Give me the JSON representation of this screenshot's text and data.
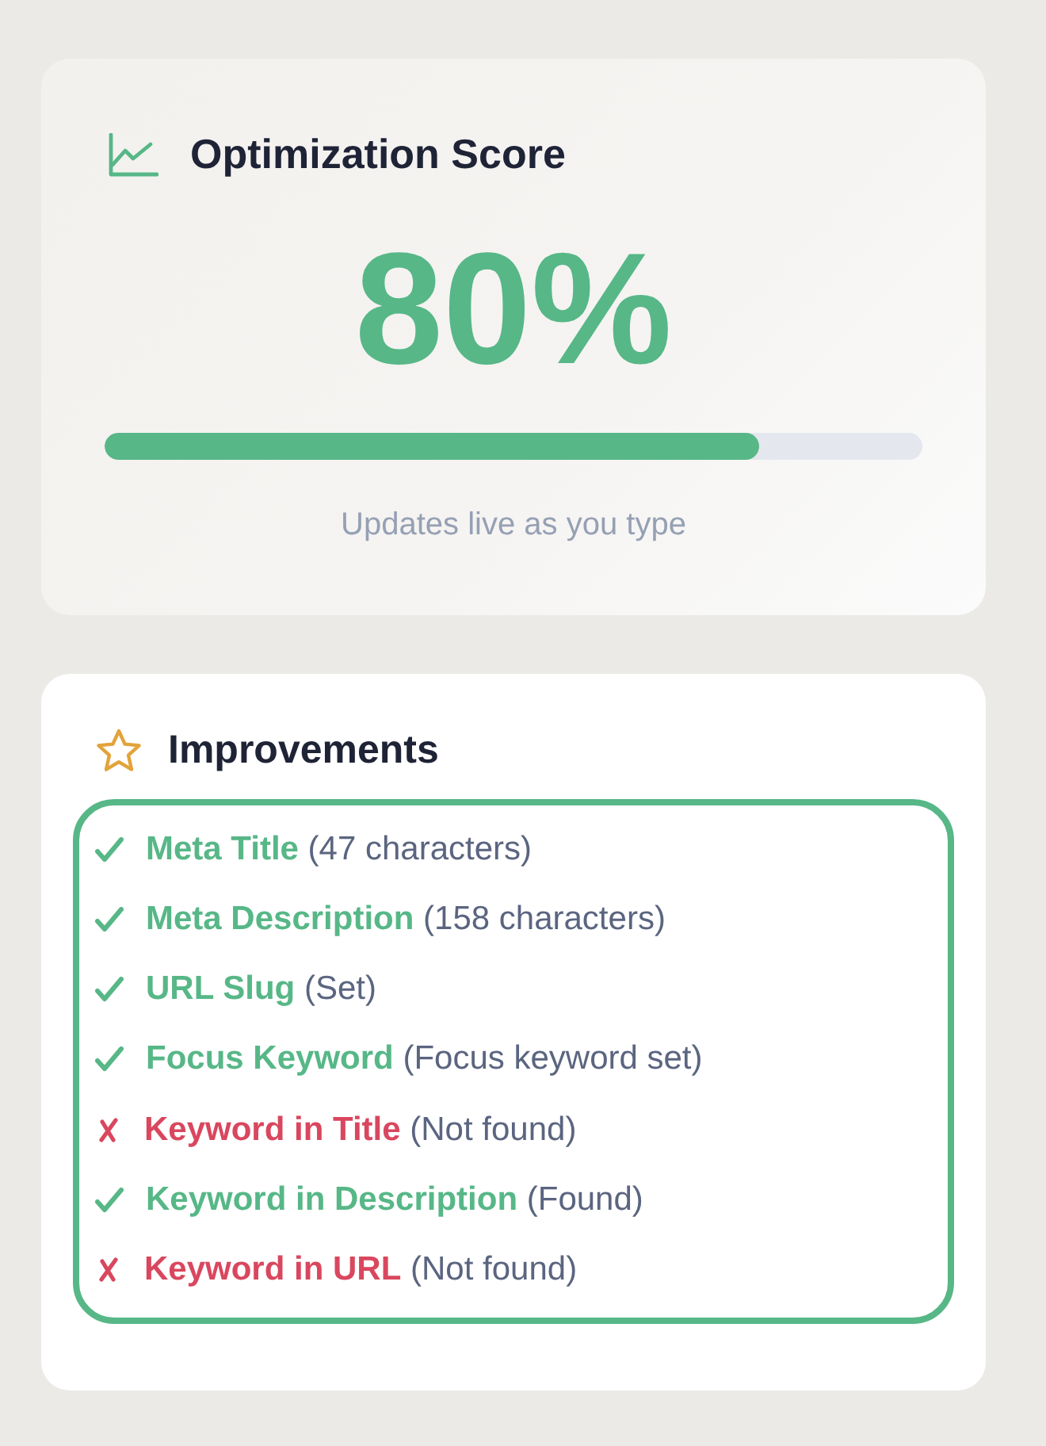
{
  "score_card": {
    "title": "Optimization Score",
    "score": "80%",
    "progress": {
      "level": 0.8
    },
    "note": "Updates live as you type"
  },
  "improvements_card": {
    "title": "Improvements",
    "items": [
      {
        "label": "Meta Title",
        "detail": "(47 characters)",
        "passed": true
      },
      {
        "label": "Meta Description",
        "detail": "(158 characters)",
        "passed": true
      },
      {
        "label": "URL Slug",
        "detail": "(Set)",
        "passed": true
      },
      {
        "label": "Focus Keyword",
        "detail": "(Focus keyword set)",
        "passed": true
      },
      {
        "label": "Keyword in Title",
        "detail": "(Not found)",
        "passed": false
      },
      {
        "label": "Keyword in Description",
        "detail": "(Found)",
        "passed": true
      },
      {
        "label": "Keyword in URL",
        "detail": "(Not found)",
        "passed": false
      }
    ]
  }
}
